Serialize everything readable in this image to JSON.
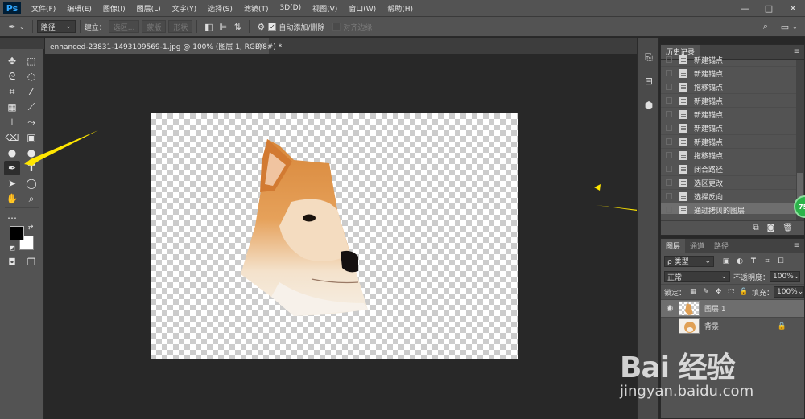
{
  "app": {
    "logo": "Ps"
  },
  "menu": [
    "文件(F)",
    "编辑(E)",
    "图像(I)",
    "图层(L)",
    "文字(Y)",
    "选择(S)",
    "滤镜(T)",
    "3D(D)",
    "视图(V)",
    "窗口(W)",
    "帮助(H)"
  ],
  "window_controls": {
    "minimize": "—",
    "restore": "□",
    "close": "✕"
  },
  "options_bar": {
    "mode": "路径",
    "make_label": "建立：",
    "btn_selection": "选区...",
    "btn_mask": "蒙版",
    "btn_shape": "形状",
    "auto_add_delete": "自动添加/删除",
    "auto_add_delete_checked": true,
    "align_edges": "对齐边缘",
    "align_edges_checked": false
  },
  "document": {
    "tab_title": "enhanced-23831-1493109569-1.jpg @ 100% (图层 1, RGB/8#) *",
    "close": "×"
  },
  "history": {
    "tabs": [
      "历史记录"
    ],
    "items": [
      "新建锚点",
      "新建锚点",
      "拖移锚点",
      "新建锚点",
      "新建锚点",
      "新建锚点",
      "新建锚点",
      "拖移锚点",
      "闭合路径",
      "选区更改",
      "选择反向",
      "通过拷贝的图层"
    ],
    "selected_index": 11
  },
  "badge": {
    "text": "75"
  },
  "layers": {
    "tabs": [
      "图层",
      "通道",
      "路径"
    ],
    "filter_kind": "类型",
    "blend_mode": "正常",
    "opacity_label": "不透明度：",
    "opacity": "100%",
    "lock_label": "锁定：",
    "fill_label": "填充：",
    "fill": "100%",
    "items": [
      {
        "name": "图层 1",
        "visible": true,
        "selected": true
      },
      {
        "name": "背景",
        "visible": false,
        "selected": false,
        "locked": true
      }
    ]
  },
  "watermark": {
    "main": "Bai 经验",
    "url": "jingyan.baidu.com"
  },
  "colors": {
    "ui_dark": "#535353",
    "canvas_bg": "#282828",
    "arrow": "#ffe600",
    "badge": "#2cb34a"
  }
}
